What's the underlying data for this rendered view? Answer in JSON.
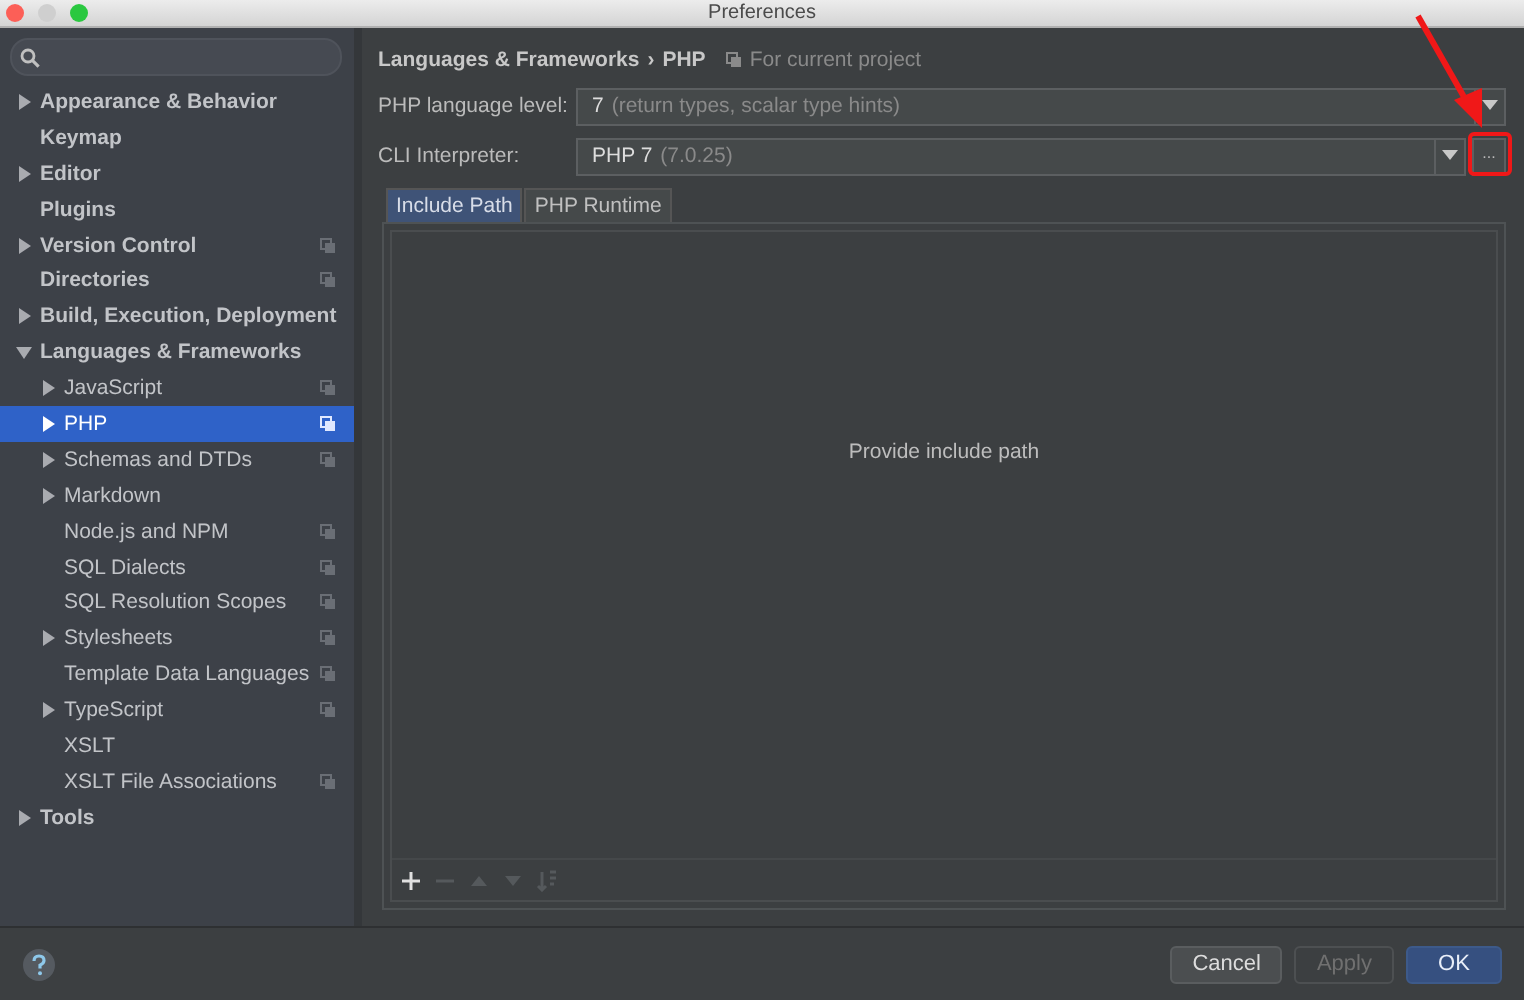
{
  "window": {
    "title": "Preferences"
  },
  "sidebar": {
    "items": [
      {
        "label": "Appearance & Behavior",
        "kind": "folder",
        "expanded": false,
        "project_level": false,
        "selected": false
      },
      {
        "label": "Keymap",
        "kind": "page",
        "project_level": false,
        "selected": false
      },
      {
        "label": "Editor",
        "kind": "folder",
        "expanded": false,
        "project_level": false,
        "selected": false
      },
      {
        "label": "Plugins",
        "kind": "page",
        "project_level": false,
        "selected": false
      },
      {
        "label": "Version Control",
        "kind": "folder",
        "expanded": false,
        "project_level": true,
        "selected": false
      },
      {
        "label": "Directories",
        "kind": "page",
        "project_level": true,
        "selected": false
      },
      {
        "label": "Build, Execution, Deployment",
        "kind": "folder",
        "expanded": false,
        "project_level": false,
        "selected": false
      },
      {
        "label": "Languages & Frameworks",
        "kind": "folder",
        "expanded": true,
        "project_level": false,
        "selected": false,
        "children": [
          {
            "label": "JavaScript",
            "kind": "folder",
            "expanded": false,
            "project_level": true,
            "selected": false
          },
          {
            "label": "PHP",
            "kind": "folder",
            "expanded": false,
            "project_level": true,
            "selected": true
          },
          {
            "label": "Schemas and DTDs",
            "kind": "folder",
            "expanded": false,
            "project_level": true,
            "selected": false
          },
          {
            "label": "Markdown",
            "kind": "folder",
            "expanded": false,
            "project_level": false,
            "selected": false
          },
          {
            "label": "Node.js and NPM",
            "kind": "page",
            "project_level": true,
            "selected": false
          },
          {
            "label": "SQL Dialects",
            "kind": "page",
            "project_level": true,
            "selected": false
          },
          {
            "label": "SQL Resolution Scopes",
            "kind": "page",
            "project_level": true,
            "selected": false
          },
          {
            "label": "Stylesheets",
            "kind": "folder",
            "expanded": false,
            "project_level": true,
            "selected": false
          },
          {
            "label": "Template Data Languages",
            "kind": "page",
            "project_level": true,
            "selected": false
          },
          {
            "label": "TypeScript",
            "kind": "folder",
            "expanded": false,
            "project_level": true,
            "selected": false
          },
          {
            "label": "XSLT",
            "kind": "page",
            "project_level": false,
            "selected": false
          },
          {
            "label": "XSLT File Associations",
            "kind": "page",
            "project_level": true,
            "selected": false
          }
        ]
      },
      {
        "label": "Tools",
        "kind": "folder",
        "expanded": false,
        "project_level": false,
        "selected": false
      }
    ]
  },
  "breadcrumb": {
    "path": [
      "Languages & Frameworks",
      "PHP"
    ],
    "separator": "›",
    "scope": "For current project"
  },
  "fields": [
    {
      "label": "PHP language level:",
      "value": "7",
      "hint": "(return types, scalar type hints)"
    },
    {
      "label": "CLI Interpreter:",
      "value": "PHP 7",
      "hint": "(7.0.25)",
      "browse_button": "..."
    }
  ],
  "tabs": [
    {
      "label": "Include Path",
      "selected": true
    },
    {
      "label": "PHP Runtime",
      "selected": false
    }
  ],
  "empty_text": "Provide include path",
  "toolbar": [
    {
      "kind": "add",
      "disabled": false
    },
    {
      "kind": "remove",
      "disabled": true
    },
    {
      "kind": "up",
      "disabled": true
    },
    {
      "kind": "down",
      "disabled": true
    },
    {
      "kind": "sort",
      "disabled": true
    }
  ],
  "buttons": [
    {
      "label": "Cancel",
      "default": false,
      "disabled": false
    },
    {
      "label": "Apply",
      "default": false,
      "disabled": true
    },
    {
      "label": "OK",
      "default": true,
      "disabled": false
    }
  ]
}
